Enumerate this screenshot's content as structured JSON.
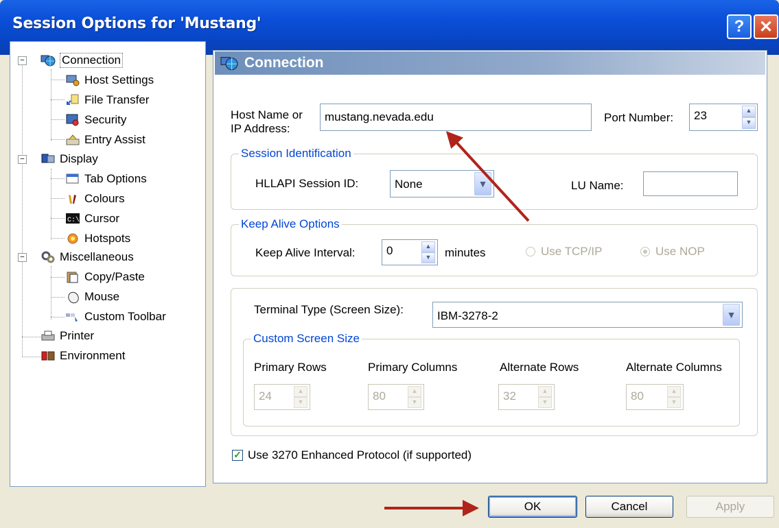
{
  "window": {
    "title": "Session Options for 'Mustang'",
    "help_label": "?",
    "close_label": "✕"
  },
  "tree": {
    "items": [
      {
        "label": "Connection",
        "icon": "network-globe-icon"
      },
      {
        "label": "Host Settings",
        "icon": "host-settings-icon"
      },
      {
        "label": "File Transfer",
        "icon": "file-transfer-icon"
      },
      {
        "label": "Security",
        "icon": "security-icon"
      },
      {
        "label": "Entry Assist",
        "icon": "entry-assist-icon"
      },
      {
        "label": "Display",
        "icon": "display-icon"
      },
      {
        "label": "Tab Options",
        "icon": "tab-options-icon"
      },
      {
        "label": "Colours",
        "icon": "colours-icon"
      },
      {
        "label": "Cursor",
        "icon": "cursor-icon"
      },
      {
        "label": "Hotspots",
        "icon": "hotspots-icon"
      },
      {
        "label": "Miscellaneous",
        "icon": "miscellaneous-icon"
      },
      {
        "label": "Copy/Paste",
        "icon": "copy-paste-icon"
      },
      {
        "label": "Mouse",
        "icon": "mouse-icon"
      },
      {
        "label": "Custom Toolbar",
        "icon": "custom-toolbar-icon"
      },
      {
        "label": "Printer",
        "icon": "printer-icon"
      },
      {
        "label": "Environment",
        "icon": "environment-icon"
      }
    ],
    "expander_symbol": "−"
  },
  "connection": {
    "header": "Connection",
    "host_label_line1": "Host Name or",
    "host_label_line2": "IP Address:",
    "host_value": "mustang.nevada.edu",
    "port_label": "Port Number:",
    "port_value": "23",
    "session_group": "Session Identification",
    "hllapi_label": "HLLAPI Session ID:",
    "hllapi_value": "None",
    "lu_label": "LU Name:",
    "lu_value": "",
    "keepalive_group": "Keep Alive Options",
    "keepalive_label": "Keep Alive Interval:",
    "keepalive_value": "0",
    "minutes_label": "minutes",
    "tcpip_label": "Use TCP/IP",
    "nop_label": "Use NOP",
    "terminal_label": "Terminal Type (Screen Size):",
    "terminal_value": "IBM-3278-2",
    "custom_group": "Custom Screen Size",
    "primary_rows_label": "Primary Rows",
    "primary_rows_value": "24",
    "primary_cols_label": "Primary Columns",
    "primary_cols_value": "80",
    "alt_rows_label": "Alternate Rows",
    "alt_rows_value": "32",
    "alt_cols_label": "Alternate Columns",
    "alt_cols_value": "80",
    "enhanced_label": "Use 3270 Enhanced Protocol (if supported)",
    "enhanced_checked": true
  },
  "buttons": {
    "ok": "OK",
    "cancel": "Cancel",
    "apply": "Apply"
  },
  "colors": {
    "titlebar": "#0a4fd8",
    "annotation_arrow": "#b0241b",
    "group_legend": "#0046d5"
  }
}
